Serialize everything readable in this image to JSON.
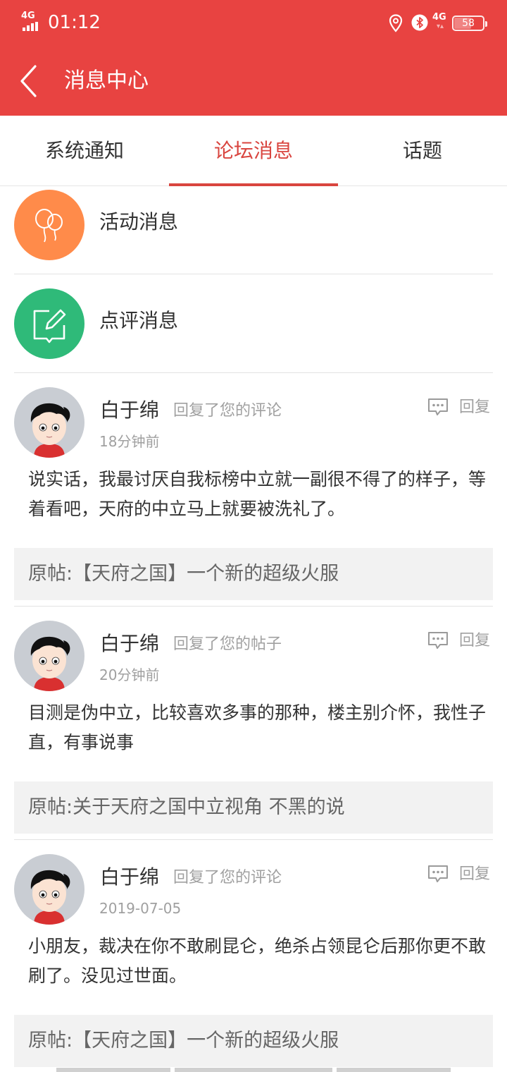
{
  "status_bar": {
    "network_left": "4G",
    "time": "01:12",
    "network_right": "4G",
    "battery_level": "58"
  },
  "header": {
    "title": "消息中心"
  },
  "tabs": [
    {
      "label": "系统通知",
      "active": false
    },
    {
      "label": "论坛消息",
      "active": true
    },
    {
      "label": "话题",
      "active": false
    }
  ],
  "entries": [
    {
      "label": "活动消息",
      "icon": "balloon-icon",
      "color": "#FF8B4A"
    },
    {
      "label": "点评消息",
      "icon": "edit-comment-icon",
      "color": "#2FBA79"
    }
  ],
  "messages": [
    {
      "user": "白于绵",
      "action": "回复了您的评论",
      "time": "18分钟前",
      "reply_label": "回复",
      "text": "说实话，我最讨厌自我标榜中立就一副很不得了的样子，等着看吧，天府的中立马上就要被洗礼了。",
      "original": "原帖:【天府之国】一个新的超级火服"
    },
    {
      "user": "白于绵",
      "action": "回复了您的帖子",
      "time": "20分钟前",
      "reply_label": "回复",
      "text": "目测是伪中立，比较喜欢多事的那种，楼主别介怀，我性子直，有事说事",
      "original": "原帖:关于天府之国中立视角 不黑的说"
    },
    {
      "user": "白于绵",
      "action": "回复了您的评论",
      "time": "2019-07-05",
      "reply_label": "回复",
      "text": "小朋友，裁决在你不敢刷昆仑，绝杀占领昆仑后那你更不敢刷了。没见过世面。",
      "original": "原帖:【天府之国】一个新的超级火服"
    }
  ],
  "colors": {
    "brand": "#E84341",
    "tab_active": "#D9453F",
    "activity": "#FF8B4A",
    "review": "#2FBA79"
  }
}
